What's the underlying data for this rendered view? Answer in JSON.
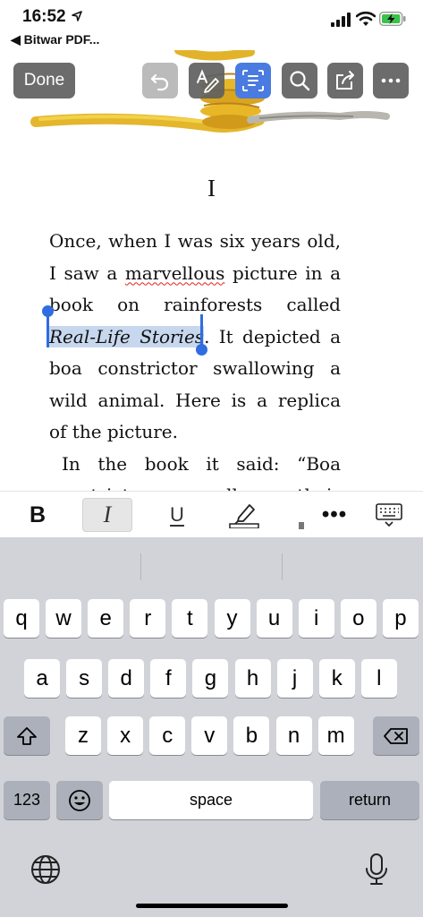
{
  "status_bar": {
    "time": "16:52",
    "back_app_label": "◀ Bitwar PDF..."
  },
  "toolbar": {
    "done_label": "Done",
    "buttons": [
      {
        "name": "undo",
        "icon": "undo-icon",
        "state": "disabled"
      },
      {
        "name": "pen",
        "icon": "pen-markup-icon",
        "state": "normal"
      },
      {
        "name": "text-edit",
        "icon": "text-box-icon",
        "state": "active"
      },
      {
        "name": "search",
        "icon": "search-icon",
        "state": "normal"
      },
      {
        "name": "share",
        "icon": "share-icon",
        "state": "normal"
      },
      {
        "name": "more",
        "icon": "more-icon",
        "state": "normal"
      }
    ]
  },
  "document": {
    "chapter": "I",
    "lines": {
      "l1": "Once, when I was six years old,",
      "l2_a": "I saw a ",
      "l2_misspelled": "marvellous",
      "l2_b": " picture in a",
      "l3": "book on rainforests called",
      "l4_selected": "Real-Life Stories",
      "l4_b": ". It depicted a",
      "l5": "boa constrictor swallowing a",
      "l6": "wild animal. Here is a replica",
      "l7": "of the picture.",
      "l8": "In the book it said: “Boa",
      "l9": "constrictors swallow their"
    }
  },
  "format_bar": {
    "bold_label": "B",
    "italic_label": "I",
    "underline_label": "U",
    "more_label": "•••"
  },
  "keyboard": {
    "row1": [
      "q",
      "w",
      "e",
      "r",
      "t",
      "y",
      "u",
      "i",
      "o",
      "p"
    ],
    "row2": [
      "a",
      "s",
      "d",
      "f",
      "g",
      "h",
      "j",
      "k",
      "l"
    ],
    "row3": [
      "z",
      "x",
      "c",
      "v",
      "b",
      "n",
      "m"
    ],
    "numbers_label": "123",
    "space_label": "space",
    "return_label": "return"
  },
  "colors": {
    "accent": "#2f6de0",
    "selection": "#c7d7ee",
    "toolbar_button": "#5f5f5f",
    "active_button": "#4a7be0",
    "keyboard_bg": "#d1d3d9"
  }
}
